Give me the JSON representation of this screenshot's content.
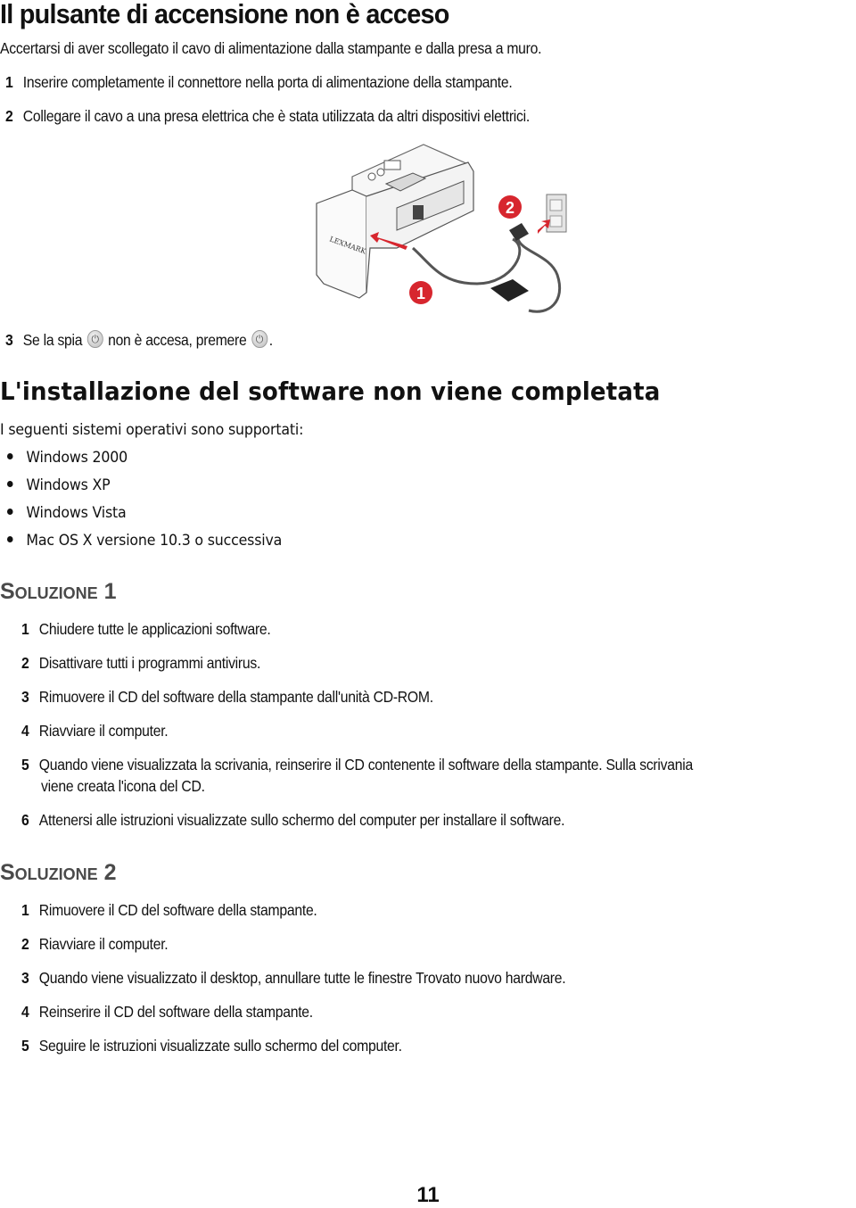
{
  "section1": {
    "title": "Il pulsante di accensione non è acceso",
    "intro": "Accertarsi di aver scollegato il cavo di alimentazione dalla stampante e dalla presa a muro.",
    "steps": [
      {
        "num": "1",
        "text": "Inserire completamente il connettore nella porta di alimentazione della stampante."
      },
      {
        "num": "2",
        "text": "Collegare il cavo a una presa elettrica che è stata utilizzata da altri dispositivi elettrici."
      }
    ],
    "figure": {
      "brand_label": "LEXMARK",
      "callout_1": "1",
      "callout_2": "2",
      "accent_color": "#d7262e"
    },
    "step3": {
      "num": "3",
      "text_a": "Se la spia",
      "text_b": "non è accesa, premere",
      "text_c": ".",
      "icon": "power-icon"
    }
  },
  "section2": {
    "title": "L'installazione del software non viene completata",
    "intro": "I seguenti sistemi operativi sono supportati:",
    "os_list": [
      "Windows 2000",
      "Windows XP",
      "Windows Vista",
      "Mac OS X versione 10.3 o successiva"
    ],
    "solution1": {
      "title": "Soluzione 1",
      "steps": [
        {
          "num": "1",
          "text": "Chiudere tutte le applicazioni software."
        },
        {
          "num": "2",
          "text": "Disattivare tutti i programmi antivirus."
        },
        {
          "num": "3",
          "text": "Rimuovere il CD del software della stampante dall'unità CD-ROM."
        },
        {
          "num": "4",
          "text": "Riavviare il computer."
        },
        {
          "num": "5",
          "text": "Quando viene visualizzata la scrivania, reinserire il CD contenente il software della stampante. Sulla scrivania",
          "text2": "viene creata l'icona del CD."
        },
        {
          "num": "6",
          "text": "Attenersi alle istruzioni visualizzate sullo schermo del computer per installare il software."
        }
      ]
    },
    "solution2": {
      "title": "Soluzione 2",
      "steps": [
        {
          "num": "1",
          "text": "Rimuovere il CD del software della stampante."
        },
        {
          "num": "2",
          "text": "Riavviare il computer."
        },
        {
          "num": "3",
          "text": "Quando viene visualizzato il desktop, annullare tutte le finestre Trovato nuovo hardware."
        },
        {
          "num": "4",
          "text": "Reinserire il CD del software della stampante."
        },
        {
          "num": "5",
          "text": "Seguire le istruzioni visualizzate sullo schermo del computer."
        }
      ]
    }
  },
  "footer": {
    "page_number": "11"
  }
}
